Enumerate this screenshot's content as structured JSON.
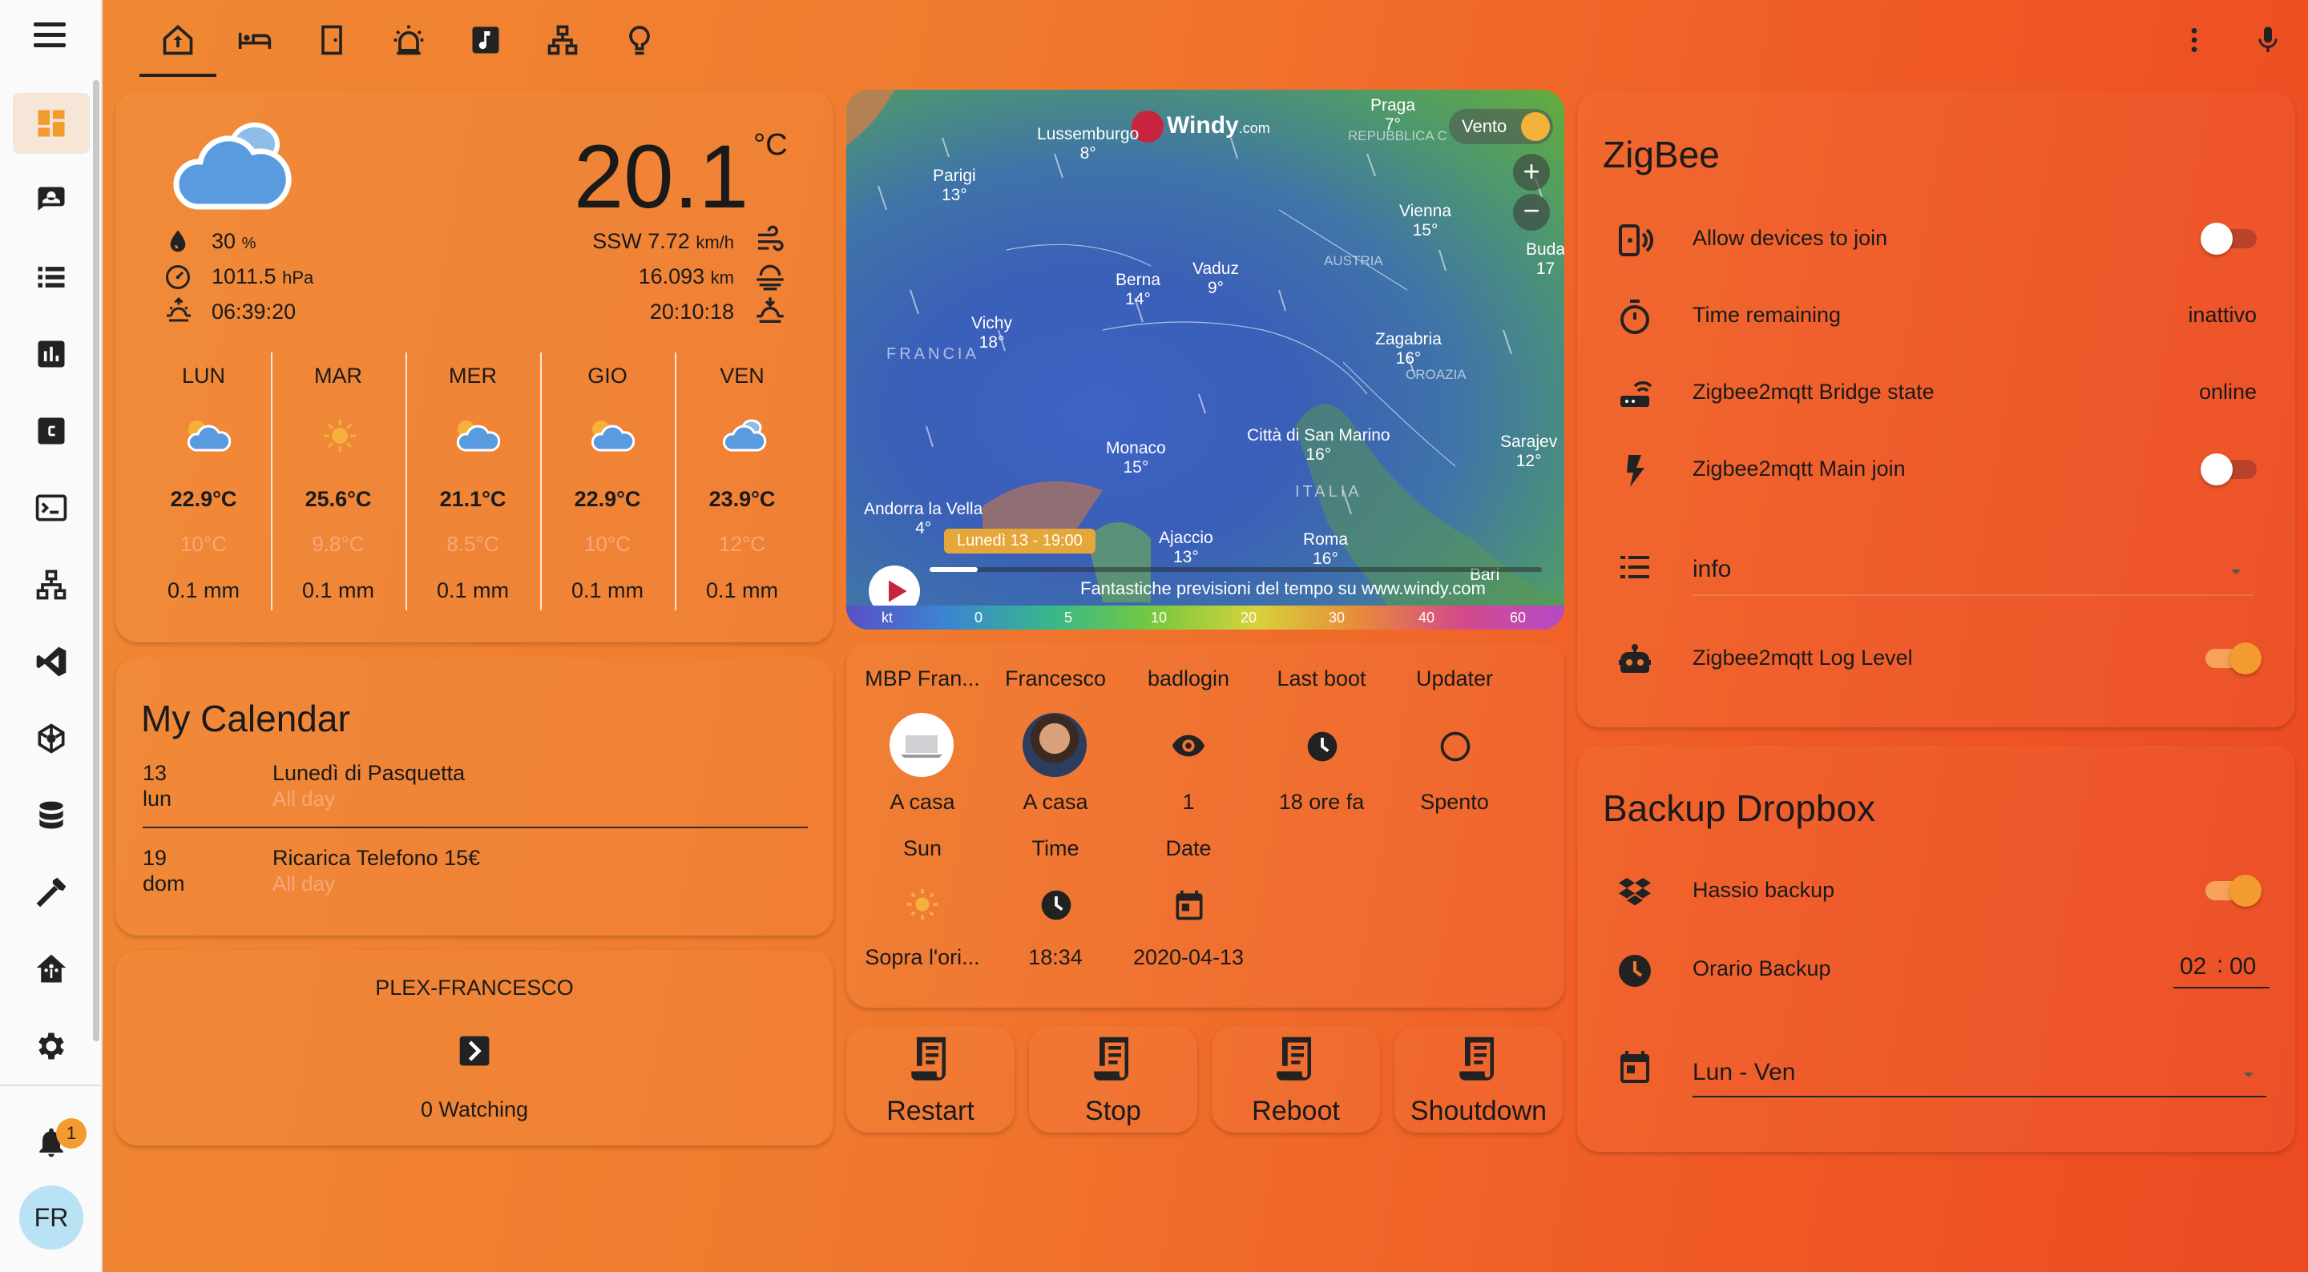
{
  "sidebar": {
    "badge_count": "1",
    "user_initials": "FR"
  },
  "weather": {
    "temperature": "20.1",
    "unit": "°C",
    "humidity": "30",
    "humidity_unit": "%",
    "pressure": "1011.5",
    "pressure_unit": "hPa",
    "sunrise": "06:39:20",
    "wind": "SSW 7.72",
    "wind_unit": "km/h",
    "visibility": "16.093",
    "visibility_unit": "km",
    "sunset": "20:10:18",
    "forecast": [
      {
        "day": "LUN",
        "high": "22.9°C",
        "low": "10°C",
        "precip": "0.1 mm",
        "icon": "partly-cloudy-icon"
      },
      {
        "day": "MAR",
        "high": "25.6°C",
        "low": "9.8°C",
        "precip": "0.1 mm",
        "icon": "sunny-icon"
      },
      {
        "day": "MER",
        "high": "21.1°C",
        "low": "8.5°C",
        "precip": "0.1 mm",
        "icon": "partly-cloudy-icon"
      },
      {
        "day": "GIO",
        "high": "22.9°C",
        "low": "10°C",
        "precip": "0.1 mm",
        "icon": "partly-cloudy-icon"
      },
      {
        "day": "VEN",
        "high": "23.9°C",
        "low": "12°C",
        "precip": "0.1 mm",
        "icon": "cloudy-icon"
      }
    ]
  },
  "calendar": {
    "title": "My Calendar",
    "events": [
      {
        "day": "13",
        "weekday": "lun",
        "title": "Lunedì di Pasquetta",
        "when": "All day"
      },
      {
        "day": "19",
        "weekday": "dom",
        "title": "Ricarica Telefono 15€",
        "when": "All day"
      }
    ]
  },
  "plex": {
    "title": "PLEX-FRANCESCO",
    "status": "0 Watching"
  },
  "map": {
    "brand": "Windy",
    "brand_suffix": ".com",
    "layer": "Vento",
    "timeline_label": "Lunedì 13 - 19:00",
    "credit": "Fantastiche previsioni del tempo su www.windy.com",
    "scale_unit": "kt",
    "scale_ticks": [
      "0",
      "5",
      "10",
      "20",
      "30",
      "40",
      "60"
    ],
    "places": [
      {
        "name": "Lussemburgo",
        "temp": "8°"
      },
      {
        "name": "Praga",
        "temp": "7°"
      },
      {
        "name": "Parigi",
        "temp": "13°"
      },
      {
        "name": "Vienna",
        "temp": "15°"
      },
      {
        "name": "Berna",
        "temp": "14°"
      },
      {
        "name": "Vaduz",
        "temp": "9°"
      },
      {
        "name": "Vichy",
        "temp": "18°"
      },
      {
        "name": "Zagabria",
        "temp": "16°"
      },
      {
        "name": "Monaco",
        "temp": "15°"
      },
      {
        "name": "Città di San Marino",
        "temp": "16°"
      },
      {
        "name": "Sarajev",
        "temp": "12°"
      },
      {
        "name": "Andorra la Vella",
        "temp": "4°"
      },
      {
        "name": "Ajaccio",
        "temp": "13°"
      },
      {
        "name": "Roma",
        "temp": "16°"
      },
      {
        "name": "Bari",
        "temp": ""
      },
      {
        "name": "Buda",
        "temp": "17"
      }
    ],
    "regions": [
      "REPUBBLICA C",
      "AUSTRIA",
      "FRANCIA",
      "CROAZIA",
      "ITALIA"
    ]
  },
  "glances": {
    "row1": [
      {
        "name": "MBP Fran...",
        "state": "A casa"
      },
      {
        "name": "Francesco",
        "state": "A casa"
      },
      {
        "name": "badlogin",
        "state": "1"
      },
      {
        "name": "Last boot",
        "state": "18 ore fa"
      },
      {
        "name": "Updater",
        "state": "Spento"
      }
    ],
    "row2": [
      {
        "name": "Sun",
        "state": "Sopra l'ori..."
      },
      {
        "name": "Time",
        "state": "18:34"
      },
      {
        "name": "Date",
        "state": "2020-04-13"
      }
    ]
  },
  "buttons": [
    "Restart",
    "Stop",
    "Reboot",
    "Shoutdown"
  ],
  "zigbee": {
    "title": "ZigBee",
    "allow_join": "Allow devices to join",
    "time_remaining": "Time remaining",
    "time_remaining_value": "inattivo",
    "bridge_state": "Zigbee2mqtt Bridge state",
    "bridge_state_value": "online",
    "main_join": "Zigbee2mqtt Main join",
    "log_level_value": "info",
    "log_level": "Zigbee2mqtt Log Level"
  },
  "backup": {
    "title": "Backup Dropbox",
    "hassio": "Hassio backup",
    "time_label": "Orario Backup",
    "time_hours": "02",
    "time_minutes": "00",
    "days": "Lun - Ven"
  },
  "colors": {
    "accent": "#f39b2e",
    "background_start": "#f08a34",
    "background_end": "#ec4a22"
  }
}
